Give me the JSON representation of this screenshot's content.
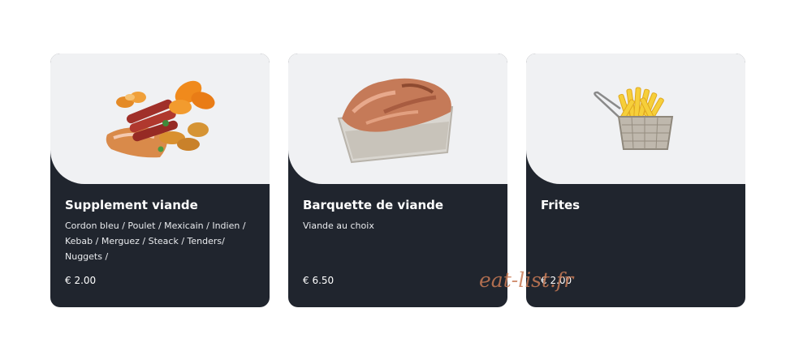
{
  "cards": [
    {
      "title": "Supplement viande",
      "description": "Cordon bleu / Poulet / Mexicain / Indien / Kebab / Merguez / Steack / Tenders/ Nuggets /",
      "price": "€ 2.00",
      "image_icon": "meat-assortment-icon"
    },
    {
      "title": "Barquette de viande",
      "description": "Viande au choix",
      "price": "€ 6.50",
      "image_icon": "meat-tray-icon"
    },
    {
      "title": "Frites",
      "description": "",
      "price": "€ 2.00",
      "image_icon": "fries-basket-icon"
    }
  ],
  "watermark": "eat-list.fr",
  "colors": {
    "card_bottom": "#20252e",
    "card_top": "#f0f1f3",
    "watermark": "#c87a55"
  }
}
